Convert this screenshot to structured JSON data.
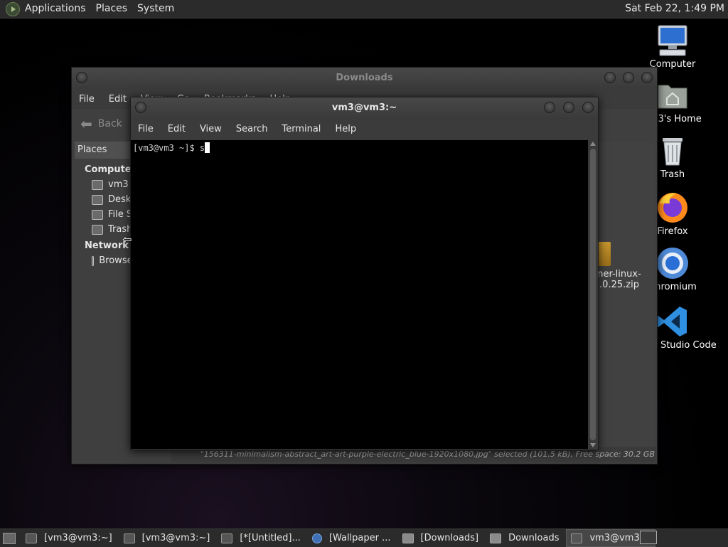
{
  "top_panel": {
    "menus": [
      "Applications",
      "Places",
      "System"
    ],
    "clock": "Sat Feb 22, 1:49 PM"
  },
  "desktop_icons": [
    {
      "label": "Computer",
      "icon": "computer-icon"
    },
    {
      "label": "vm3's Home",
      "icon": "home-folder-icon"
    },
    {
      "label": "Trash",
      "icon": "trash-icon"
    },
    {
      "label": "Firefox",
      "icon": "firefox-icon"
    },
    {
      "label": "Chromium",
      "icon": "chromium-icon"
    },
    {
      "label": "Visual Studio Code",
      "icon": "vscode-icon"
    }
  ],
  "downloads_window": {
    "title": "Downloads",
    "menus": [
      "File",
      "Edit",
      "View",
      "Go",
      "Bookmarks",
      "Help"
    ],
    "back_label": "Back",
    "sidebar": {
      "header": "Places",
      "computer_label": "Computer",
      "computer_items": [
        "vm3",
        "Desktop",
        "File System",
        "Trash"
      ],
      "network_label": "Network",
      "network_items": [
        "Browse Network"
      ]
    },
    "file_label": "ner-linux-\n.0.25.zip",
    "status": "\"156311-minimalism-abstract_art-art-purple-electric_blue-1920x1080.jpg\" selected (101.5 kB), Free space: 30.2 GB"
  },
  "terminal_window": {
    "title": "vm3@vm3:~",
    "menus": [
      "File",
      "Edit",
      "View",
      "Search",
      "Terminal",
      "Help"
    ],
    "prompt": "[vm3@vm3 ~]$ s"
  },
  "taskbar": {
    "tasks": [
      {
        "label": "[vm3@vm3:~]",
        "icon": "terminal-icon"
      },
      {
        "label": "[vm3@vm3:~]",
        "icon": "terminal-icon"
      },
      {
        "label": "[*[Untitled]...",
        "icon": "editor-icon"
      },
      {
        "label": "[Wallpaper ...",
        "icon": "chromium-icon"
      },
      {
        "label": "[Downloads]",
        "icon": "folder-icon"
      },
      {
        "label": "Downloads",
        "icon": "folder-icon"
      },
      {
        "label": "vm3@vm3:~",
        "icon": "terminal-icon"
      }
    ]
  },
  "colors": {
    "panel_bg": "#2b2b2b",
    "window_bg": "#3b3b3b",
    "terminal_bg": "#000000",
    "vscode_blue": "#2f8fe0",
    "firefox_orange": "#ff8a1c"
  }
}
